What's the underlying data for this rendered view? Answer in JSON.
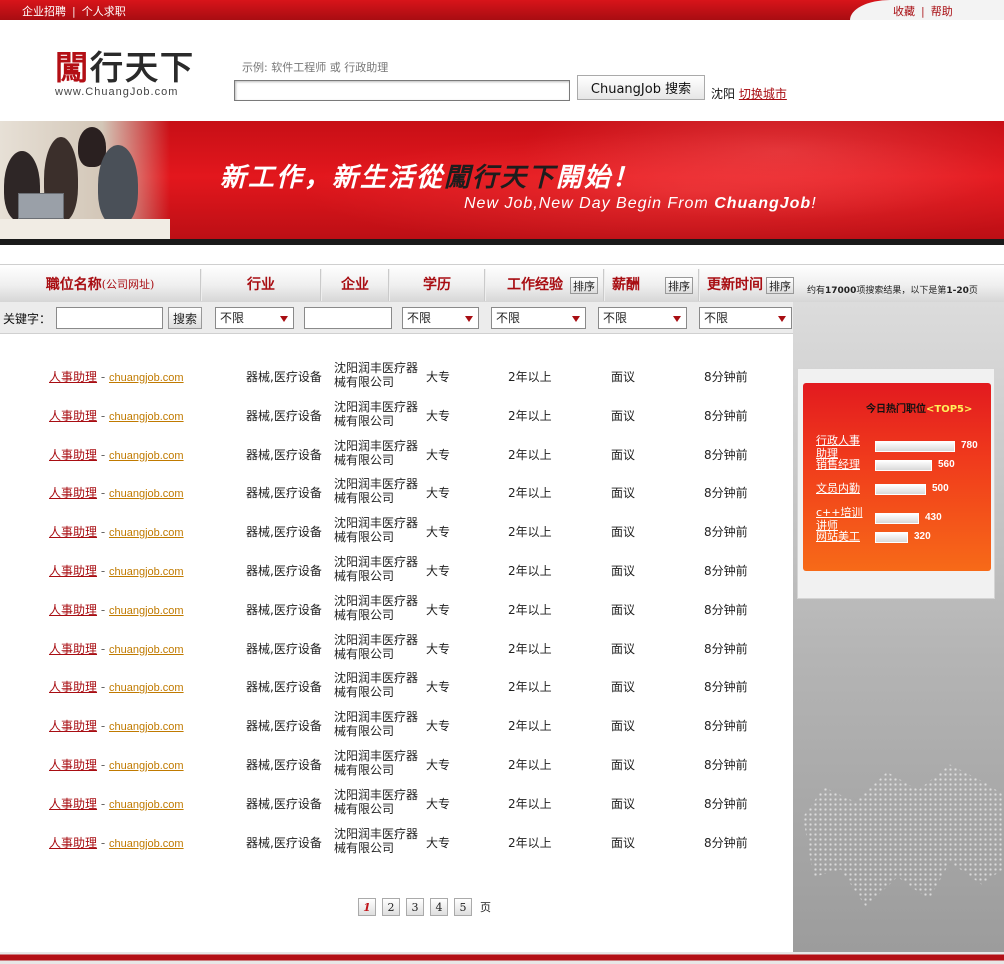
{
  "topbar": {
    "left_links": [
      "企业招聘",
      "个人求职"
    ],
    "right_links": [
      "收藏",
      "帮助"
    ]
  },
  "logo": {
    "text": "闖行天下",
    "url": "www.ChuangJob.com"
  },
  "search": {
    "example": "示例: 软件工程师  或  行政助理",
    "value": "",
    "button": "ChuangJob 搜索",
    "city": "沈阳",
    "switch_city": "切换城市"
  },
  "banner": {
    "slogan_cn_a": "新工作，新生活從",
    "slogan_cn_b": "闖行天下",
    "slogan_cn_c": "開始！",
    "slogan_en_a": "New Job,New Day Begin From ",
    "slogan_en_b": "ChuangJob",
    "slogan_en_c": "!"
  },
  "columns": {
    "title": "職位名称",
    "title_sub": "(公司网址)",
    "industry": "行业",
    "company": "企业",
    "education": "学历",
    "experience": "工作经验",
    "salary": "薪酬",
    "updated": "更新时间",
    "sort": "排序"
  },
  "result_info": {
    "prefix": "约有",
    "count": "17000",
    "middle": "项搜索结果，以下是第",
    "range": "1-20",
    "suffix": "页"
  },
  "filters": {
    "keyword_label": "关键字：",
    "keyword_value": "",
    "search_button": "搜索",
    "industry_select": "不限",
    "company_value": "",
    "education_select": "不限",
    "experience_select": "不限",
    "salary_select": "不限",
    "updated_select": "不限"
  },
  "jobs": [
    {
      "title": "人事助理",
      "site": "chuangjob.com",
      "industry": "器械,医疗设备",
      "company": "沈阳润丰医疗器械有限公司",
      "education": "大专",
      "experience": "2年以上",
      "salary": "面议",
      "updated": "8分钟前"
    },
    {
      "title": "人事助理",
      "site": "chuangjob.com",
      "industry": "器械,医疗设备",
      "company": "沈阳润丰医疗器械有限公司",
      "education": "大专",
      "experience": "2年以上",
      "salary": "面议",
      "updated": "8分钟前"
    },
    {
      "title": "人事助理",
      "site": "chuangjob.com",
      "industry": "器械,医疗设备",
      "company": "沈阳润丰医疗器械有限公司",
      "education": "大专",
      "experience": "2年以上",
      "salary": "面议",
      "updated": "8分钟前"
    },
    {
      "title": "人事助理",
      "site": "chuangjob.com",
      "industry": "器械,医疗设备",
      "company": "沈阳润丰医疗器械有限公司",
      "education": "大专",
      "experience": "2年以上",
      "salary": "面议",
      "updated": "8分钟前"
    },
    {
      "title": "人事助理",
      "site": "chuangjob.com",
      "industry": "器械,医疗设备",
      "company": "沈阳润丰医疗器械有限公司",
      "education": "大专",
      "experience": "2年以上",
      "salary": "面议",
      "updated": "8分钟前"
    },
    {
      "title": "人事助理",
      "site": "chuangjob.com",
      "industry": "器械,医疗设备",
      "company": "沈阳润丰医疗器械有限公司",
      "education": "大专",
      "experience": "2年以上",
      "salary": "面议",
      "updated": "8分钟前"
    },
    {
      "title": "人事助理",
      "site": "chuangjob.com",
      "industry": "器械,医疗设备",
      "company": "沈阳润丰医疗器械有限公司",
      "education": "大专",
      "experience": "2年以上",
      "salary": "面议",
      "updated": "8分钟前"
    },
    {
      "title": "人事助理",
      "site": "chuangjob.com",
      "industry": "器械,医疗设备",
      "company": "沈阳润丰医疗器械有限公司",
      "education": "大专",
      "experience": "2年以上",
      "salary": "面议",
      "updated": "8分钟前"
    },
    {
      "title": "人事助理",
      "site": "chuangjob.com",
      "industry": "器械,医疗设备",
      "company": "沈阳润丰医疗器械有限公司",
      "education": "大专",
      "experience": "2年以上",
      "salary": "面议",
      "updated": "8分钟前"
    },
    {
      "title": "人事助理",
      "site": "chuangjob.com",
      "industry": "器械,医疗设备",
      "company": "沈阳润丰医疗器械有限公司",
      "education": "大专",
      "experience": "2年以上",
      "salary": "面议",
      "updated": "8分钟前"
    },
    {
      "title": "人事助理",
      "site": "chuangjob.com",
      "industry": "器械,医疗设备",
      "company": "沈阳润丰医疗器械有限公司",
      "education": "大专",
      "experience": "2年以上",
      "salary": "面议",
      "updated": "8分钟前"
    },
    {
      "title": "人事助理",
      "site": "chuangjob.com",
      "industry": "器械,医疗设备",
      "company": "沈阳润丰医疗器械有限公司",
      "education": "大专",
      "experience": "2年以上",
      "salary": "面议",
      "updated": "8分钟前"
    },
    {
      "title": "人事助理",
      "site": "chuangjob.com",
      "industry": "器械,医疗设备",
      "company": "沈阳润丰医疗器械有限公司",
      "education": "大专",
      "experience": "2年以上",
      "salary": "面议",
      "updated": "8分钟前"
    }
  ],
  "top5": {
    "title": "今日热门职位",
    "badge": "<TOP5>",
    "items": [
      {
        "name": "行政人事助理",
        "count": 780
      },
      {
        "name": "销售经理",
        "count": 560
      },
      {
        "name": "文员内勤",
        "count": 500
      },
      {
        "name": "c++培训讲师",
        "count": 430
      },
      {
        "name": "网站美工",
        "count": 320
      }
    ]
  },
  "pager": {
    "pages": [
      "1",
      "2",
      "3",
      "4",
      "5"
    ],
    "current": "1",
    "unit": "页"
  },
  "colors": {
    "brand_red": "#a80d12",
    "banner_red": "#e3171d",
    "link_orange": "#c07a00"
  }
}
